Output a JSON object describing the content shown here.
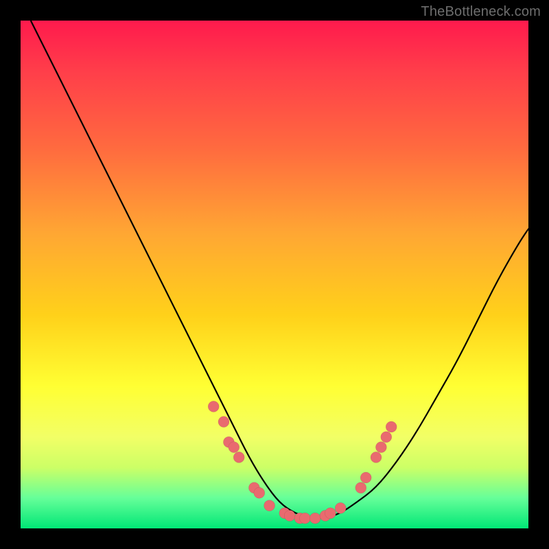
{
  "watermark": "TheBottleneck.com",
  "chart_data": {
    "type": "line",
    "title": "",
    "xlabel": "",
    "ylabel": "",
    "xlim": [
      0,
      100
    ],
    "ylim": [
      0,
      100
    ],
    "series": [
      {
        "name": "curve",
        "x": [
          2,
          6,
          10,
          14,
          18,
          22,
          26,
          30,
          34,
          38,
          42,
          45,
          48,
          51,
          54,
          57,
          60,
          63,
          66,
          70,
          74,
          78,
          82,
          86,
          90,
          94,
          98,
          100
        ],
        "y": [
          100,
          92,
          84,
          76,
          68,
          60,
          52,
          44,
          36,
          28,
          20,
          14,
          9,
          5,
          3,
          2,
          2,
          3,
          5,
          8,
          13,
          19,
          26,
          33,
          41,
          49,
          56,
          59
        ]
      }
    ],
    "markers": [
      {
        "x": 38,
        "y": 24
      },
      {
        "x": 40,
        "y": 21
      },
      {
        "x": 41,
        "y": 17
      },
      {
        "x": 42,
        "y": 16
      },
      {
        "x": 43,
        "y": 14
      },
      {
        "x": 46,
        "y": 8
      },
      {
        "x": 47,
        "y": 7
      },
      {
        "x": 49,
        "y": 4.5
      },
      {
        "x": 52,
        "y": 3
      },
      {
        "x": 53,
        "y": 2.5
      },
      {
        "x": 55,
        "y": 2
      },
      {
        "x": 56,
        "y": 2
      },
      {
        "x": 58,
        "y": 2
      },
      {
        "x": 60,
        "y": 2.5
      },
      {
        "x": 61,
        "y": 3
      },
      {
        "x": 63,
        "y": 4
      },
      {
        "x": 67,
        "y": 8
      },
      {
        "x": 68,
        "y": 10
      },
      {
        "x": 70,
        "y": 14
      },
      {
        "x": 71,
        "y": 16
      },
      {
        "x": 72,
        "y": 18
      },
      {
        "x": 73,
        "y": 20
      }
    ],
    "colors": {
      "marker": "#e96a6f",
      "curve": "#000000",
      "gradient_top": "#ff1a4d",
      "gradient_bottom": "#00e676"
    }
  }
}
